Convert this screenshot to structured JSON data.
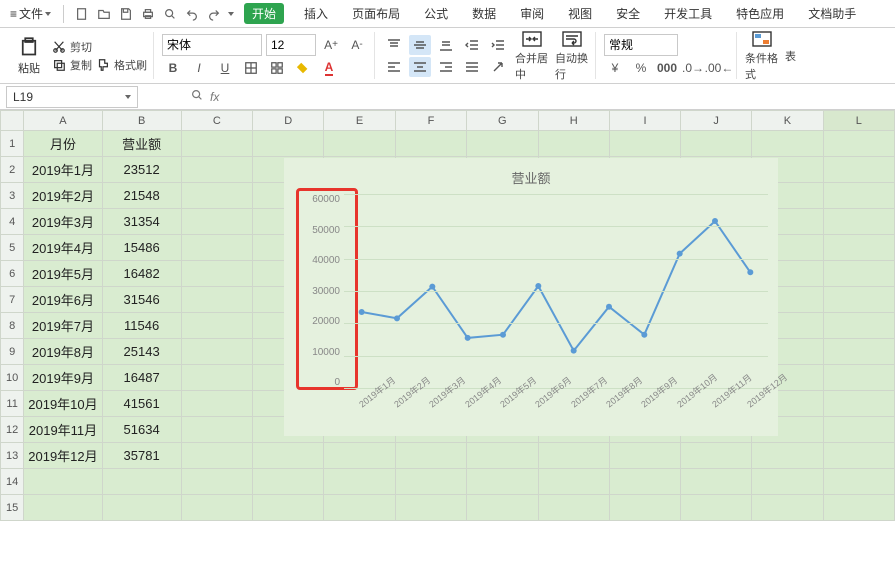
{
  "menubar": {
    "file_label": "文件",
    "tabs": [
      "开始",
      "插入",
      "页面布局",
      "公式",
      "数据",
      "审阅",
      "视图",
      "安全",
      "开发工具",
      "特色应用",
      "文档助手"
    ],
    "active_tab_index": 0
  },
  "ribbon": {
    "paste_label": "粘贴",
    "cut_label": "剪切",
    "copy_label": "复制",
    "format_painter_label": "格式刷",
    "font_name": "宋体",
    "font_size": "12",
    "merge_center_label": "合并居中",
    "wrap_text_label": "自动换行",
    "number_format": "常规",
    "cond_format_label": "条件格式"
  },
  "namebox": {
    "value": "L19"
  },
  "sheet": {
    "columns": [
      "A",
      "B",
      "C",
      "D",
      "E",
      "F",
      "G",
      "H",
      "I",
      "J",
      "K",
      "L"
    ],
    "headers": {
      "A": "月份",
      "B": "营业额"
    },
    "rows": [
      {
        "A": "2019年1月",
        "B": "23512"
      },
      {
        "A": "2019年2月",
        "B": "21548"
      },
      {
        "A": "2019年3月",
        "B": "31354"
      },
      {
        "A": "2019年4月",
        "B": "15486"
      },
      {
        "A": "2019年5月",
        "B": "16482"
      },
      {
        "A": "2019年6月",
        "B": "31546"
      },
      {
        "A": "2019年7月",
        "B": "11546"
      },
      {
        "A": "2019年8月",
        "B": "25143"
      },
      {
        "A": "2019年9月",
        "B": "16487"
      },
      {
        "A": "2019年10月",
        "B": "41561"
      },
      {
        "A": "2019年11月",
        "B": "51634"
      },
      {
        "A": "2019年12月",
        "B": "35781"
      }
    ]
  },
  "chart_data": {
    "type": "line",
    "title": "营业额",
    "categories": [
      "2019年1月",
      "2019年2月",
      "2019年3月",
      "2019年4月",
      "2019年5月",
      "2019年6月",
      "2019年7月",
      "2019年8月",
      "2019年9月",
      "2019年10月",
      "2019年11月",
      "2019年12月"
    ],
    "values": [
      23512,
      21548,
      31354,
      15486,
      16482,
      31546,
      11546,
      25143,
      16487,
      41561,
      51634,
      35781
    ],
    "ylim": [
      0,
      60000
    ],
    "yticks": [
      0,
      10000,
      20000,
      30000,
      40000,
      50000,
      60000
    ],
    "xlabel": "",
    "ylabel": "",
    "series_color": "#5b9bd5"
  }
}
